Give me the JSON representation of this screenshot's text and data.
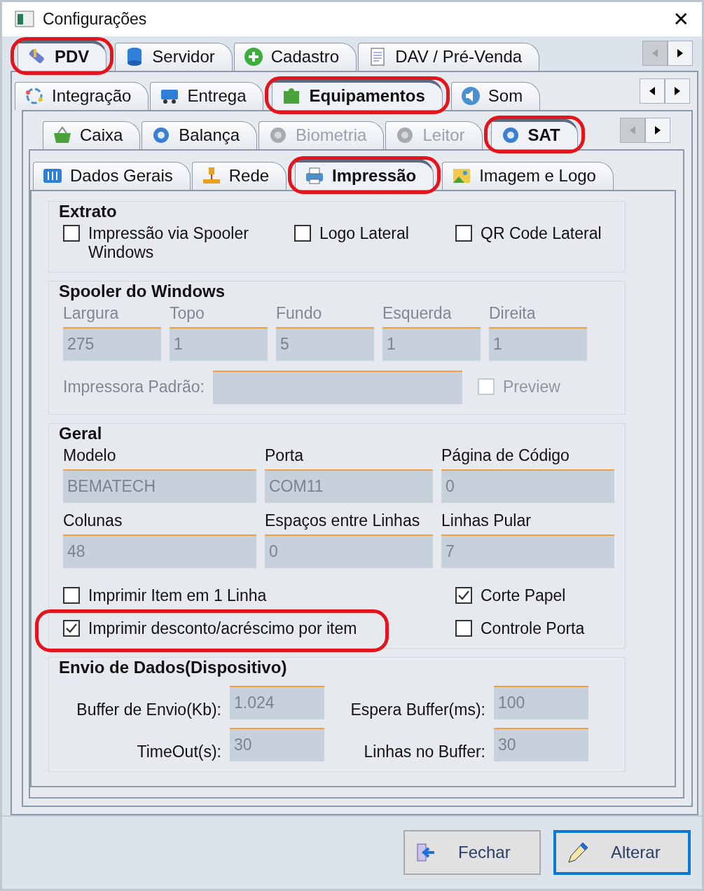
{
  "window": {
    "title": "Configurações",
    "close": "✕"
  },
  "tab_rows": [
    {
      "tabs": [
        {
          "label": "PDV",
          "selected": true,
          "disabled": false,
          "highlighted": true
        },
        {
          "label": "Servidor",
          "selected": false,
          "disabled": false,
          "highlighted": false
        },
        {
          "label": "Cadastro",
          "selected": false,
          "disabled": false,
          "highlighted": false
        },
        {
          "label": "DAV / Pré-Venda",
          "selected": false,
          "disabled": false,
          "highlighted": false
        }
      ],
      "arrows": {
        "back_enabled": false,
        "forward_enabled": true
      }
    },
    {
      "tabs": [
        {
          "label": "Integração",
          "selected": false,
          "disabled": false,
          "highlighted": false
        },
        {
          "label": "Entrega",
          "selected": false,
          "disabled": false,
          "highlighted": false
        },
        {
          "label": "Equipamentos",
          "selected": true,
          "disabled": false,
          "highlighted": true
        },
        {
          "label": "Som",
          "selected": false,
          "disabled": false,
          "highlighted": false
        }
      ],
      "arrows": {
        "back_enabled": true,
        "forward_enabled": true
      }
    },
    {
      "tabs": [
        {
          "label": "Caixa",
          "selected": false,
          "disabled": false,
          "highlighted": false
        },
        {
          "label": "Balança",
          "selected": false,
          "disabled": false,
          "highlighted": false
        },
        {
          "label": "Biometria",
          "selected": false,
          "disabled": true,
          "highlighted": false
        },
        {
          "label": "Leitor",
          "selected": false,
          "disabled": true,
          "highlighted": false
        },
        {
          "label": "SAT",
          "selected": true,
          "disabled": false,
          "highlighted": true
        }
      ],
      "arrows": {
        "back_enabled": false,
        "forward_enabled": true
      }
    },
    {
      "tabs": [
        {
          "label": "Dados Gerais",
          "selected": false,
          "disabled": false,
          "highlighted": false
        },
        {
          "label": "Rede",
          "selected": false,
          "disabled": false,
          "highlighted": false
        },
        {
          "label": "Impressão",
          "selected": true,
          "disabled": false,
          "highlighted": true
        },
        {
          "label": "Imagem e Logo",
          "selected": false,
          "disabled": false,
          "highlighted": false
        }
      ]
    }
  ],
  "extrato": {
    "title": "Extrato",
    "checkboxes": [
      {
        "label": "Impressão via Spooler Windows",
        "checked": false
      },
      {
        "label": "Logo Lateral",
        "checked": false
      },
      {
        "label": "QR Code Lateral",
        "checked": false
      }
    ]
  },
  "spooler": {
    "title": "Spooler do Windows",
    "disabled": true,
    "fields": [
      {
        "label": "Largura",
        "value": "275"
      },
      {
        "label": "Topo",
        "value": "1"
      },
      {
        "label": "Fundo",
        "value": "5"
      },
      {
        "label": "Esquerda",
        "value": "1"
      },
      {
        "label": "Direita",
        "value": "1"
      }
    ],
    "printer_label": "Impressora Padrão:",
    "preview": {
      "label": "Preview",
      "checked": false
    }
  },
  "geral": {
    "title": "Geral",
    "fields": [
      {
        "label": "Modelo",
        "value": "BEMATECH"
      },
      {
        "label": "Porta",
        "value": "COM11"
      },
      {
        "label": "Página de Código",
        "value": "0"
      },
      {
        "label": "Colunas",
        "value": "48"
      },
      {
        "label": "Espaços entre Linhas",
        "value": "0"
      },
      {
        "label": "Linhas Pular",
        "value": "7"
      }
    ],
    "checkboxes": [
      {
        "label": "Imprimir Item em 1 Linha",
        "checked": false,
        "highlighted": false
      },
      {
        "label": "Corte Papel",
        "checked": true,
        "highlighted": false
      },
      {
        "label": "Imprimir desconto/acréscimo por item",
        "checked": true,
        "highlighted": true
      },
      {
        "label": "Controle Porta",
        "checked": false,
        "highlighted": false
      }
    ]
  },
  "envio": {
    "title": "Envio de Dados(Dispositivo)",
    "fields": [
      {
        "label": "Buffer de Envio(Kb):",
        "value": "1.024"
      },
      {
        "label": "Espera Buffer(ms):",
        "value": "100"
      },
      {
        "label": "TimeOut(s):",
        "value": "30"
      },
      {
        "label": "Linhas no Buffer:",
        "value": "30"
      }
    ]
  },
  "buttons": [
    {
      "label": "Fechar",
      "default": false
    },
    {
      "label": "Alterar",
      "default": true
    }
  ]
}
